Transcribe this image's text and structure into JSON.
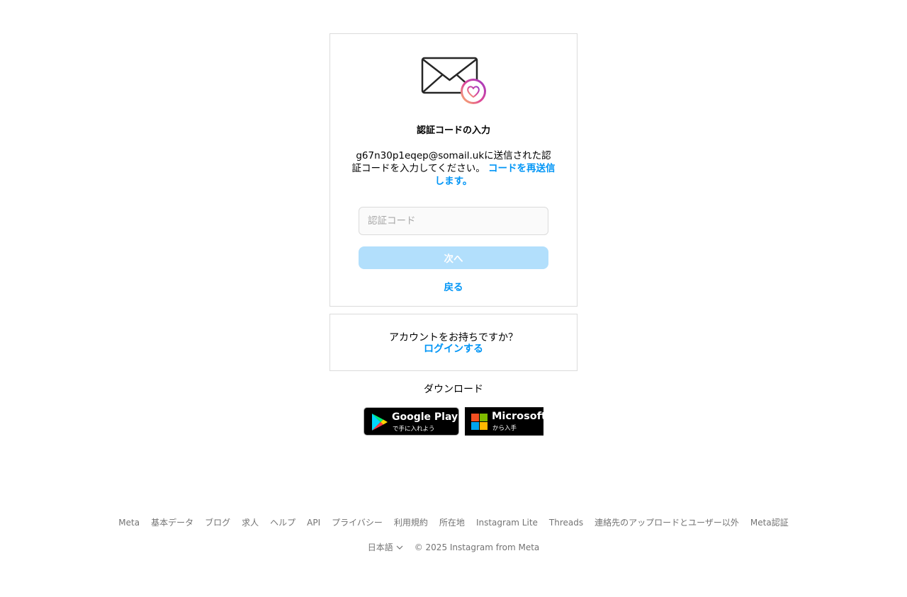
{
  "verify": {
    "title": "認証コードの入力",
    "email": "g67n30p1eqep@somail.uk",
    "desc_after_email": "に送信された認証コードを入力してください。",
    "resend_link": "コードを再送信します。",
    "code_placeholder": "認証コード",
    "code_value": "",
    "next_button": "次へ",
    "back_link": "戻る"
  },
  "login_card": {
    "question": "アカウントをお持ちですか？",
    "login_link": "ログインする"
  },
  "download": {
    "label": "ダウンロード",
    "google_play_big": "Google Play",
    "google_play_small": "で手に入れよう",
    "microsoft_big": "Microsoft",
    "microsoft_small": "から入手"
  },
  "footer": {
    "links": [
      "Meta",
      "基本データ",
      "ブログ",
      "求人",
      "ヘルプ",
      "API",
      "プライバシー",
      "利用規約",
      "所在地",
      "Instagram Lite",
      "Threads",
      "連絡先のアップロードとユーザー以外",
      "Meta認証"
    ],
    "language": "日本語",
    "copyright": "© 2025 Instagram from Meta"
  },
  "colors": {
    "accent": "#0095f6",
    "button_disabled": "#b2dffc",
    "border": "#dbdbdb",
    "muted_text": "#737373"
  },
  "icons": {
    "envelope": "envelope-heart-icon",
    "language_chevron": "chevron-down-icon"
  }
}
